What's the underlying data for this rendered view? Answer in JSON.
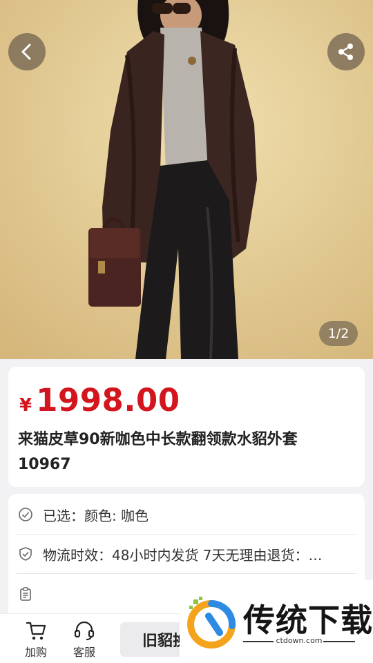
{
  "product_image": {
    "description": "model wearing long dark brown mink fur coat",
    "counter": "1/2"
  },
  "icons": {
    "back": "chevron-left-icon",
    "share": "share-icon",
    "cart": "cart-icon",
    "service": "headset-icon",
    "selected": "check-circle-icon",
    "shipping": "shield-check-icon",
    "notes": "clipboard-icon"
  },
  "price": {
    "symbol": "¥",
    "amount": "1998.00",
    "color": "#d3161e"
  },
  "product": {
    "title": "来猫皮草90新咖色中长款翻领款水貂外套10967"
  },
  "specs": {
    "selected": "已选：颜色: 咖色",
    "shipping": "物流时效：48小时内发货 7天无理由退货：…",
    "notes": ""
  },
  "bottom_bar": {
    "cart_label": "加购",
    "service_label": "客服",
    "action_label": "旧貂换"
  },
  "watermark": {
    "brand": "传统下载",
    "url": "ctdown.com"
  }
}
